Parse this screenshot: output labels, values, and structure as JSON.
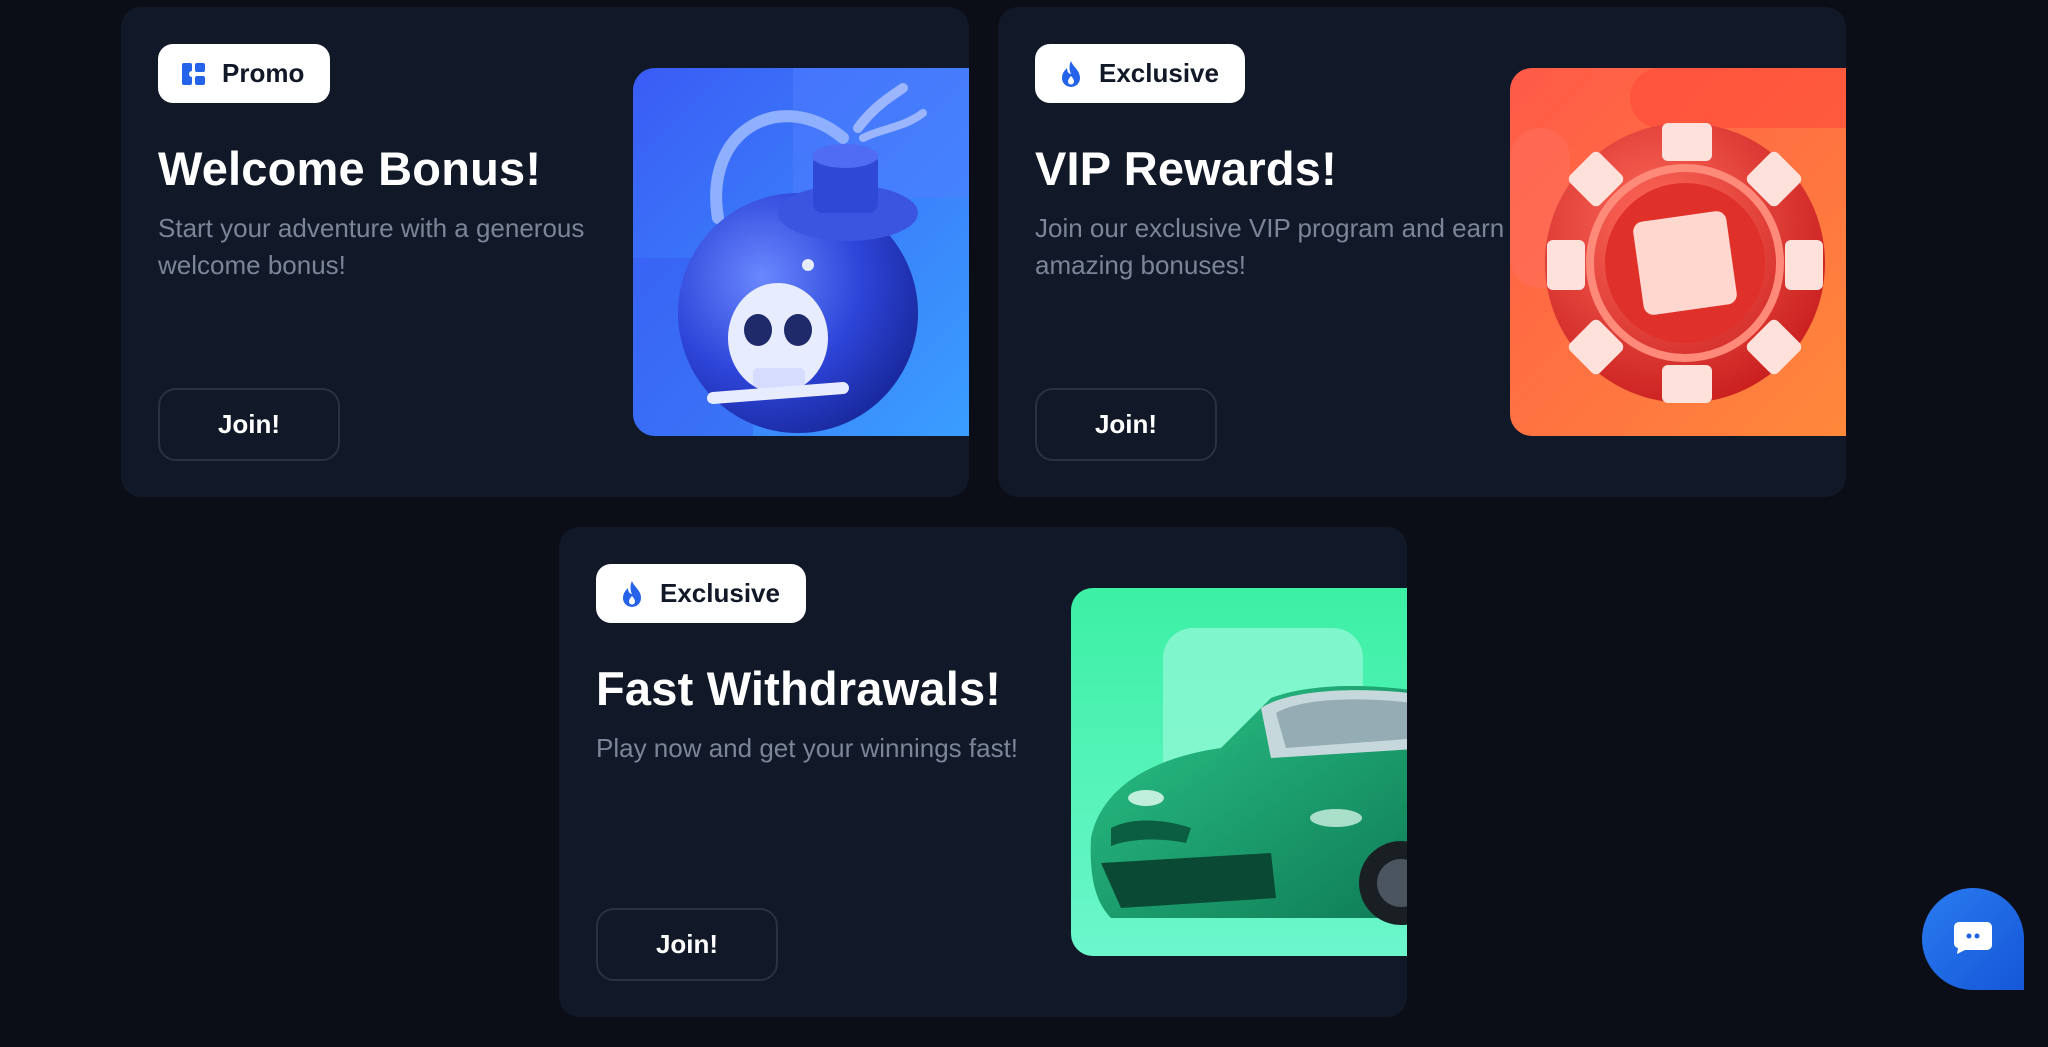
{
  "colors": {
    "background": "#0b0e16",
    "card": "#111827",
    "accent_blue": "#2563eb",
    "muted_text": "#7b8599"
  },
  "cards": [
    {
      "badge": {
        "label": "Promo",
        "icon": "ticket-icon"
      },
      "title": "Welcome Bonus!",
      "description": "Start your adventure with a generous welcome bonus!",
      "button_label": "Join!",
      "art": "pirate-bomb-illustration"
    },
    {
      "badge": {
        "label": "Exclusive",
        "icon": "flame-icon"
      },
      "title": "VIP Rewards!",
      "description": "Join our exclusive VIP program and earn amazing bonuses!",
      "button_label": "Join!",
      "art": "casino-chip-illustration"
    },
    {
      "badge": {
        "label": "Exclusive",
        "icon": "flame-icon"
      },
      "title": "Fast Withdrawals!",
      "description": "Play now and get your winnings fast!",
      "button_label": "Join!",
      "art": "sports-car-illustration"
    }
  ],
  "chat_widget": {
    "icon": "chat-bubble-icon"
  }
}
